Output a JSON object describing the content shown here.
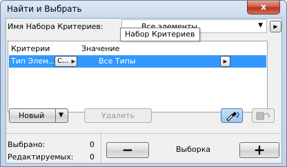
{
  "window": {
    "title": "Найти и Выбрать",
    "close_glyph": "x"
  },
  "criteria_set": {
    "label": "Имя Набора Критериев:",
    "value": "Все элементы",
    "arrow_glyph": "▼",
    "more_glyph": "▶"
  },
  "table": {
    "columns": [
      "Критерии",
      "Значение"
    ],
    "rows": [
      {
        "criterion": "Тип Элем...",
        "operator": "C...",
        "operator_glyph": "▶",
        "value": "Все Типы",
        "value_glyph": "▶"
      }
    ]
  },
  "tooltip": "Набор Критериев",
  "actions": {
    "new_label": "Новый",
    "new_arrow": "▼",
    "delete_label": "Удалить"
  },
  "stats": {
    "selected_label": "Выбрано:",
    "selected_value": "0",
    "editable_label": "Редактируемых:",
    "editable_value": "0"
  },
  "selection": {
    "label": "Выборка",
    "minus_glyph": "−",
    "plus_glyph": "+"
  }
}
